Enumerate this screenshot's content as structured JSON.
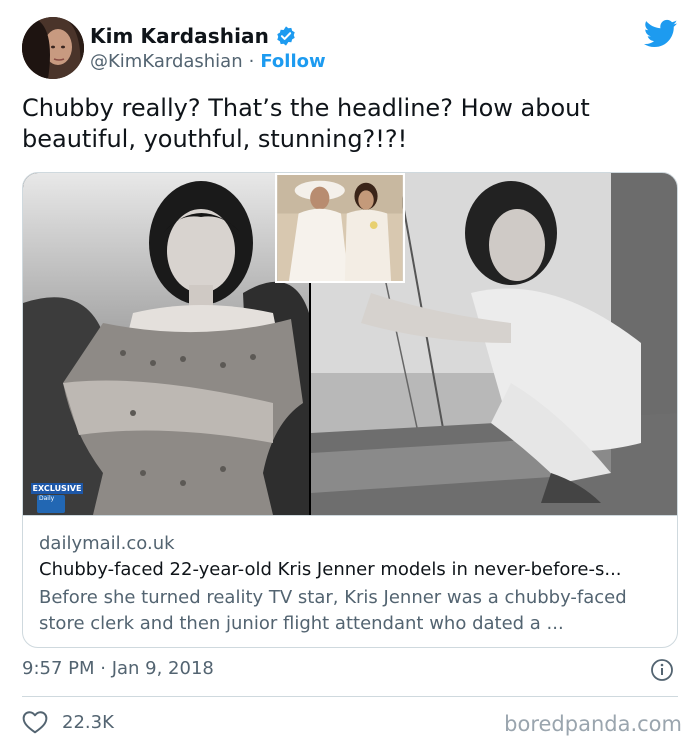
{
  "tweet": {
    "author_name": "Kim Kardashian",
    "handle": "@KimKardashian",
    "separator": "·",
    "follow_label": "Follow",
    "text": "Chubby really? That’s the headline? How about beautiful, youthful, stunning?!?!",
    "timestamp": "9:57 PM · Jan 9, 2018",
    "like_count": "22.3K"
  },
  "card": {
    "domain": "dailymail.co.uk",
    "title": "Chubby-faced 22-year-old Kris Jenner models in never-before-s...",
    "description": "Before she turned reality TV star, Kris Jenner was a chubby-faced store clerk and then junior flight attendant who dated a ...",
    "badge_exclusive": "EXCLUSIVE",
    "badge_brand": "Daily"
  },
  "watermark": "boredpanda.com",
  "colors": {
    "accent": "#1d9bf0",
    "text": "#0f1419",
    "muted": "#536471",
    "border": "#cfd9de"
  },
  "icons": {
    "verified": "verified-badge-icon",
    "twitter": "twitter-bird-icon",
    "info": "info-icon",
    "like": "heart-icon"
  }
}
